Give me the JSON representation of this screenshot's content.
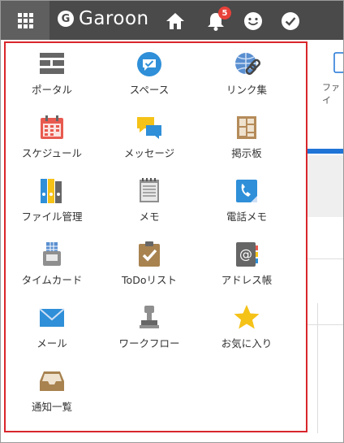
{
  "header": {
    "app_name": "Garoon",
    "logo_letter": "G",
    "notification_count": "5",
    "colors": {
      "bar": "#4a4a4a",
      "badge": "#e8413a"
    }
  },
  "menu": {
    "border_color": "#d9262c",
    "items": [
      {
        "label": "ポータル",
        "icon": "portal-icon"
      },
      {
        "label": "スペース",
        "icon": "space-icon"
      },
      {
        "label": "リンク集",
        "icon": "link-icon"
      },
      {
        "label": "スケジュール",
        "icon": "calendar-icon"
      },
      {
        "label": "メッセージ",
        "icon": "message-icon"
      },
      {
        "label": "掲示板",
        "icon": "bulletin-board-icon"
      },
      {
        "label": "ファイル管理",
        "icon": "file-binder-icon"
      },
      {
        "label": "メモ",
        "icon": "memo-icon"
      },
      {
        "label": "電話メモ",
        "icon": "phone-memo-icon"
      },
      {
        "label": "タイムカード",
        "icon": "timecard-icon"
      },
      {
        "label": "ToDoリスト",
        "icon": "todo-clipboard-icon"
      },
      {
        "label": "アドレス帳",
        "icon": "address-book-icon"
      },
      {
        "label": "メール",
        "icon": "mail-envelope-icon"
      },
      {
        "label": "ワークフロー",
        "icon": "workflow-stamp-icon"
      },
      {
        "label": "お気に入り",
        "icon": "star-icon"
      },
      {
        "label": "通知一覧",
        "icon": "notification-tray-icon"
      }
    ]
  },
  "background": {
    "tab_label": "ファイ"
  }
}
